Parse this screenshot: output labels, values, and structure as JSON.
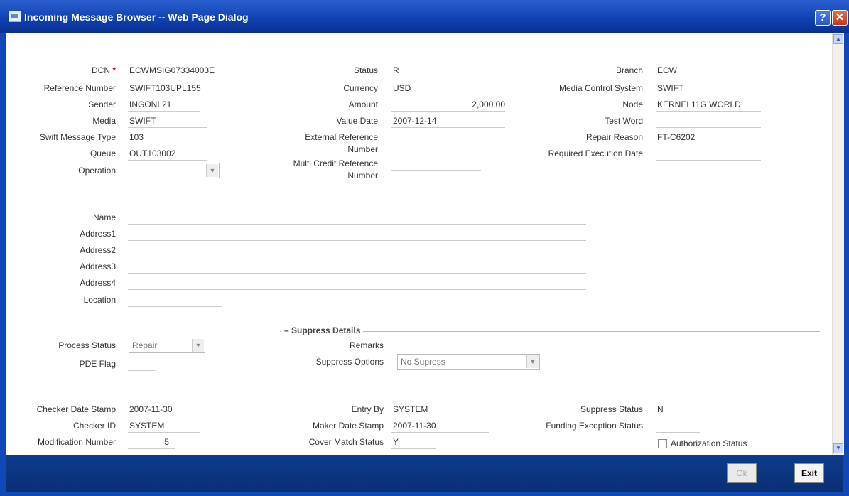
{
  "window": {
    "title": "Incoming Message Browser -- Web Page Dialog",
    "help": "?",
    "close": "✕"
  },
  "col1": {
    "dcn": {
      "label": "DCN",
      "value": "ECWMSIG07334003E",
      "required": "*"
    },
    "reference_number": {
      "label": "Reference Number",
      "value": "SWIFT103UPL155"
    },
    "sender": {
      "label": "Sender",
      "value": "INGONL21"
    },
    "media": {
      "label": "Media",
      "value": "SWIFT"
    },
    "swift_message_type": {
      "label": "Swift Message Type",
      "value": "103"
    },
    "queue": {
      "label": "Queue",
      "value": "OUT103002"
    },
    "operation": {
      "label": "Operation",
      "value": ""
    }
  },
  "col2": {
    "status": {
      "label": "Status",
      "value": "R"
    },
    "currency": {
      "label": "Currency",
      "value": "USD"
    },
    "amount": {
      "label": "Amount",
      "value": "2,000.00"
    },
    "value_date": {
      "label": "Value Date",
      "value": "2007-12-14"
    },
    "external_reference": {
      "label1": "External Reference",
      "label2": "Number",
      "value": ""
    },
    "multi_credit_reference": {
      "label1": "Multi Credit Reference",
      "label2": "Number",
      "value": ""
    }
  },
  "col3": {
    "branch": {
      "label": "Branch",
      "value": "ECW"
    },
    "media_control_system": {
      "label": "Media Control System",
      "value": "SWIFT"
    },
    "node": {
      "label": "Node",
      "value": "KERNEL11G.WORLD"
    },
    "test_word": {
      "label": "Test Word",
      "value": ""
    },
    "repair_reason": {
      "label": "Repair Reason",
      "value": "FT-C6202"
    },
    "required_execution_date": {
      "label": "Required Execution Date",
      "value": ""
    }
  },
  "address": {
    "name": {
      "label": "Name",
      "value": ""
    },
    "address1": {
      "label": "Address1",
      "value": ""
    },
    "address2": {
      "label": "Address2",
      "value": ""
    },
    "address3": {
      "label": "Address3",
      "value": ""
    },
    "address4": {
      "label": "Address4",
      "value": ""
    },
    "location": {
      "label": "Location",
      "value": ""
    }
  },
  "process": {
    "process_status": {
      "label": "Process Status",
      "value": "Repair"
    },
    "pde_flag": {
      "label": "PDE Flag",
      "value": ""
    }
  },
  "suppress": {
    "title": "Suppress Details",
    "remarks": {
      "label": "Remarks",
      "value": ""
    },
    "suppress_options": {
      "label": "Suppress Options",
      "value": "No Supress"
    }
  },
  "audit": {
    "checker_date_stamp": {
      "label": "Checker Date Stamp",
      "value": "2007-11-30"
    },
    "checker_id": {
      "label": "Checker ID",
      "value": "SYSTEM"
    },
    "modification_number": {
      "label": "Modification Number",
      "value": "5"
    },
    "entry_by": {
      "label": "Entry By",
      "value": "SYSTEM"
    },
    "maker_date_stamp": {
      "label": "Maker Date Stamp",
      "value": "2007-11-30"
    },
    "cover_match_status": {
      "label": "Cover Match Status",
      "value": "Y"
    },
    "suppress_status": {
      "label": "Suppress Status",
      "value": "N"
    },
    "funding_exception_status": {
      "label": "Funding Exception Status",
      "value": ""
    },
    "authorization_status": {
      "label": "Authorization Status",
      "checked": false
    }
  },
  "footer": {
    "ok": "Ok",
    "exit": "Exit"
  },
  "colors": {
    "titlebar": "#1040b0",
    "footer": "#0d3c8c",
    "required": "#dd0000"
  }
}
